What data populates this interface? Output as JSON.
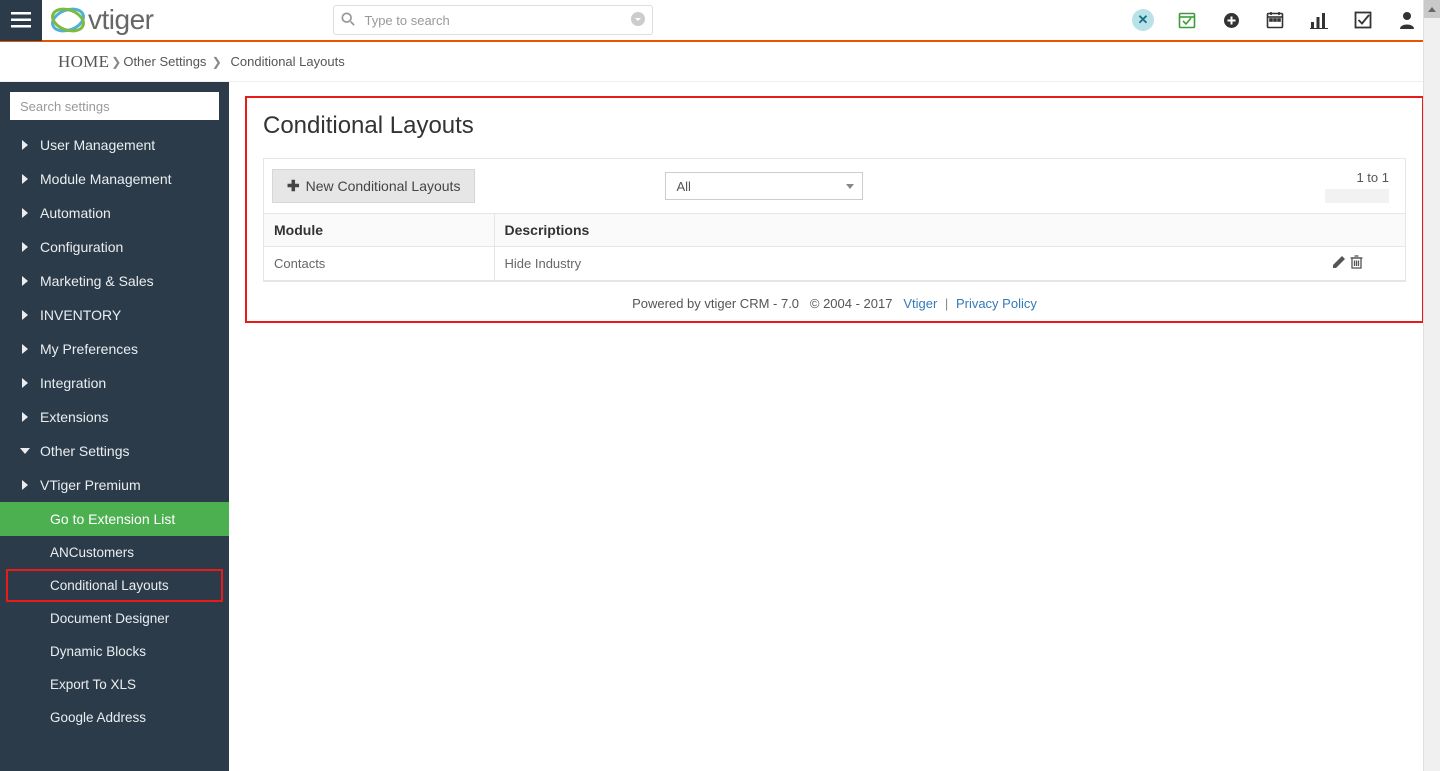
{
  "header": {
    "search_placeholder": "Type to search",
    "logo_text": "vtiger"
  },
  "breadcrumb": {
    "home": "HOME",
    "items": [
      "Other Settings",
      "Conditional Layouts"
    ]
  },
  "sidebar": {
    "search_placeholder": "Search settings",
    "nav": [
      {
        "label": "User Management",
        "expanded": false
      },
      {
        "label": "Module Management",
        "expanded": false
      },
      {
        "label": "Automation",
        "expanded": false
      },
      {
        "label": "Configuration",
        "expanded": false
      },
      {
        "label": "Marketing & Sales",
        "expanded": false
      },
      {
        "label": "INVENTORY",
        "expanded": false
      },
      {
        "label": "My Preferences",
        "expanded": false
      },
      {
        "label": "Integration",
        "expanded": false
      },
      {
        "label": "Extensions",
        "expanded": false
      },
      {
        "label": "Other Settings",
        "expanded": true
      },
      {
        "label": "VTiger Premium",
        "expanded": false
      }
    ],
    "subnav": {
      "cta": "Go to Extension List",
      "items": [
        "ANCustomers",
        "Conditional Layouts",
        "Document Designer",
        "Dynamic Blocks",
        "Export To XLS",
        "Google Address"
      ],
      "highlighted_index": 1
    }
  },
  "main": {
    "title": "Conditional Layouts",
    "new_button": "New Conditional Layouts",
    "filter_value": "All",
    "page_info": "1 to 1",
    "table": {
      "headers": {
        "module": "Module",
        "descriptions": "Descriptions"
      },
      "rows": [
        {
          "module": "Contacts",
          "description": "Hide Industry"
        }
      ]
    }
  },
  "footer": {
    "powered": "Powered by vtiger CRM - 7.0",
    "copyright": "© 2004 - 2017",
    "vendor": "Vtiger",
    "privacy": "Privacy Policy"
  }
}
